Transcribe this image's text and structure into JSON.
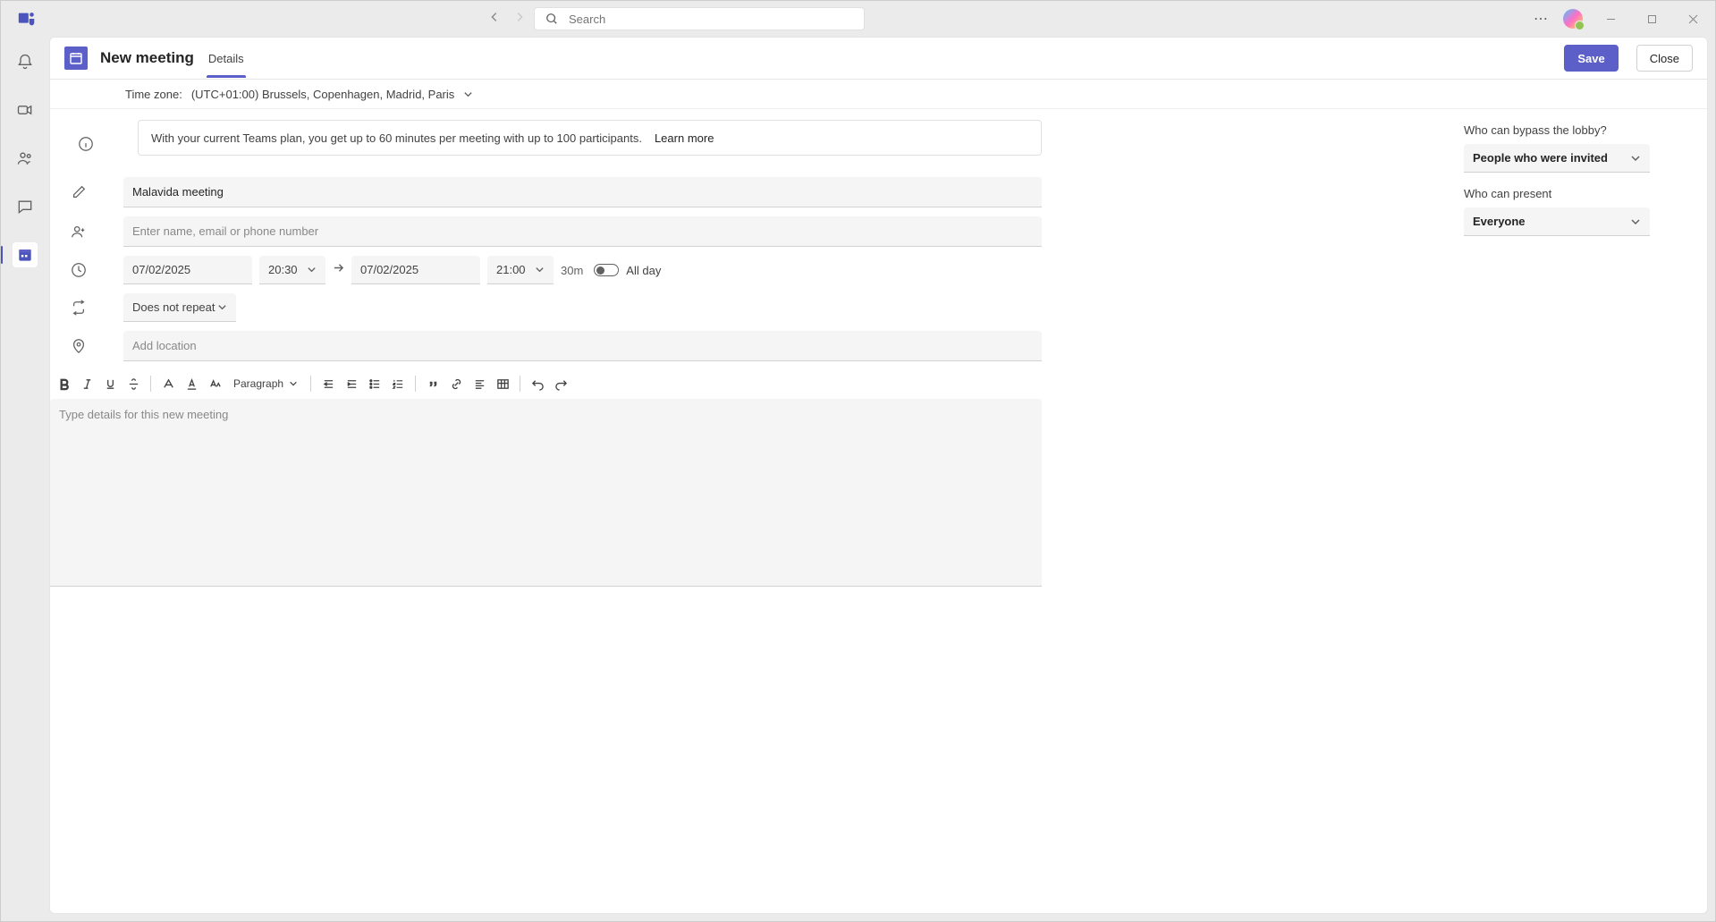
{
  "titlebar": {
    "search_placeholder": "Search"
  },
  "header": {
    "title": "New meeting",
    "tab_details": "Details",
    "save": "Save",
    "close": "Close"
  },
  "tz": {
    "label": "Time zone:",
    "value": "(UTC+01:00) Brussels, Copenhagen, Madrid, Paris"
  },
  "info": {
    "text": "With your current Teams plan, you get up to 60 minutes per meeting with up to 100 participants.",
    "learn": "Learn more"
  },
  "form": {
    "title_value": "Malavida meeting",
    "attendees_placeholder": "Enter name, email or phone number",
    "start_date": "07/02/2025",
    "start_time": "20:30",
    "end_date": "07/02/2025",
    "end_time": "21:00",
    "duration": "30m",
    "all_day": "All day",
    "repeat": "Does not repeat",
    "location_placeholder": "Add location",
    "paragraph": "Paragraph",
    "details_placeholder": "Type details for this new meeting"
  },
  "options": {
    "bypass_label": "Who can bypass the lobby?",
    "bypass_value": "People who were invited",
    "present_label": "Who can present",
    "present_value": "Everyone"
  }
}
